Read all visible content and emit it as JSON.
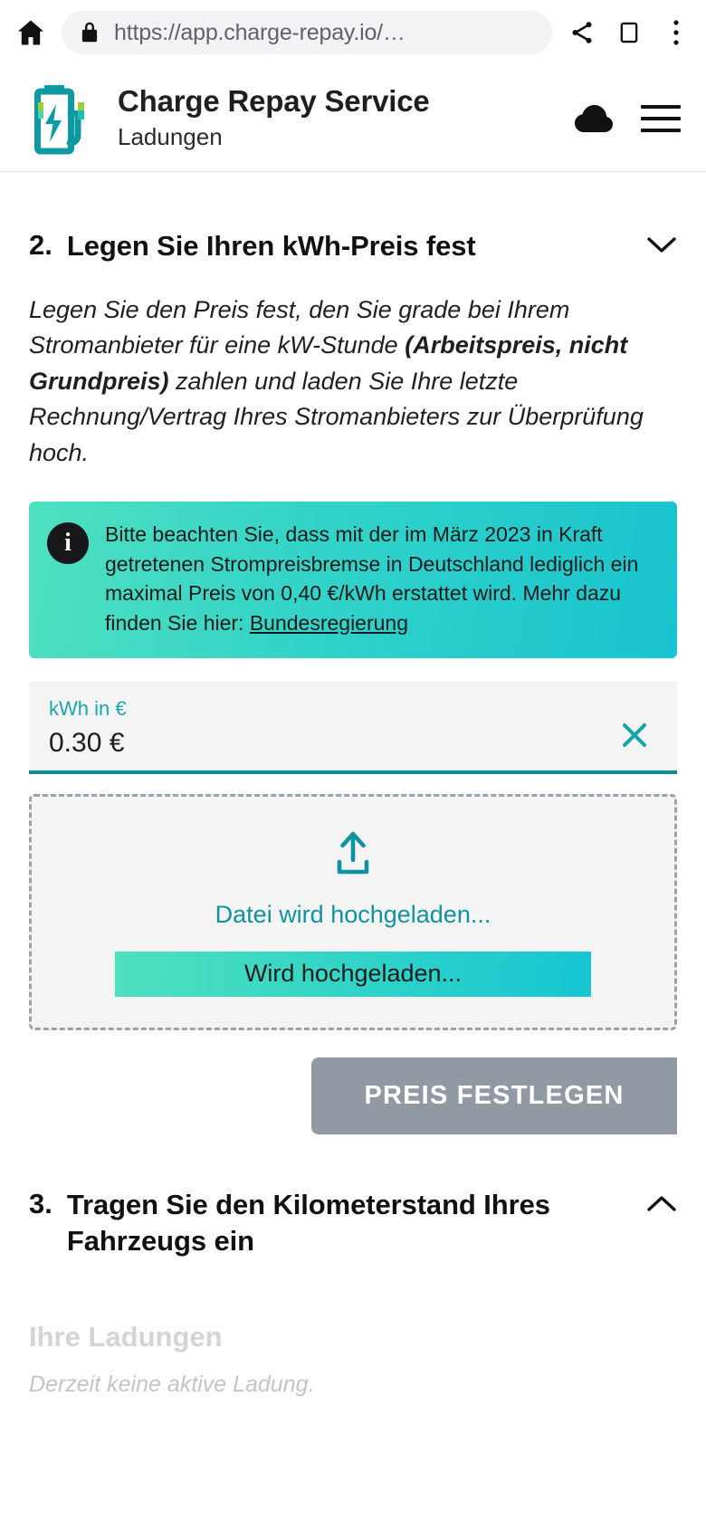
{
  "browser": {
    "url": "https://app.charge-repay.io/…",
    "home_icon": "home-icon",
    "lock_icon": "lock-icon",
    "share_icon": "share-icon",
    "tabs_icon": "tab-switcher-icon",
    "menu_icon": "overflow-menu-icon"
  },
  "header": {
    "title": "Charge Repay Service",
    "subtitle": "Ladungen",
    "logo_icon": "battery-charging-logo",
    "cloud_icon": "cloud-icon",
    "hamburger_icon": "hamburger-menu-icon"
  },
  "section2": {
    "number": "2.",
    "title": "Legen Sie Ihren kWh-Preis fest",
    "chevron_icon": "chevron-down-icon",
    "description_part1": "Legen Sie den Preis fest, den Sie grade bei Ihrem Stromanbieter für eine kW-Stunde ",
    "description_bold": "(Arbeitspreis, nicht Grundpreis)",
    "description_part2": " zahlen und laden Sie Ihre letzte Rechnung/Vertrag Ihres Stromanbieters zur Überprüfung hoch.",
    "info": {
      "icon": "info-icon",
      "text_before_link": "Bitte beachten Sie, dass mit der im März 2023 in Kraft getretenen Strompreisbremse in Deutschland lediglich ein maximal Preis von 0,40 €/kWh erstattet wird. Mehr dazu finden Sie hier: ",
      "link_label": "Bundesregierung"
    },
    "price_field": {
      "label": "kWh in €",
      "value": "0.30 €",
      "placeholder": "kWh in €",
      "clear_icon": "close-icon",
      "underline_color": "#0b8f96"
    },
    "upload": {
      "icon": "upload-icon",
      "status_text": "Datei wird hochgeladen...",
      "progress_label": "Wird hochgeladen...",
      "progress_percent": 100
    },
    "submit_label": "PREIS FESTLEGEN",
    "submit_disabled_color": "#919aa3"
  },
  "section3": {
    "number": "3.",
    "title": "Tragen Sie den Kilometerstand Ihres Fahrzeugs ein",
    "chevron_icon": "chevron-up-icon"
  },
  "footer": {
    "title": "Ihre Ladungen",
    "empty_text": "Derzeit keine aktive Ladung."
  },
  "colors": {
    "accent_teal": "#0f93a0",
    "banner_gradient_from": "#4fe0c0",
    "banner_gradient_to": "#18c4cf"
  }
}
